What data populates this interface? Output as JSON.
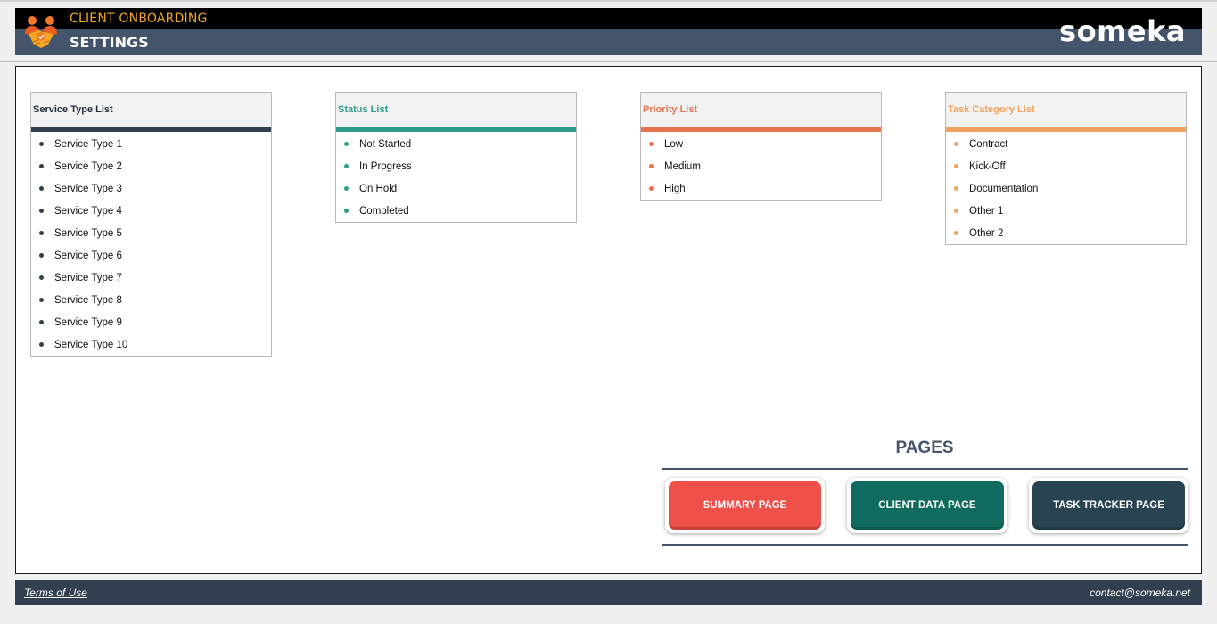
{
  "header": {
    "app_title": "CLIENT ONBOARDING",
    "page_title": "SETTINGS",
    "brand": "someka"
  },
  "lists": {
    "service": {
      "title": "Service Type List",
      "color": "#323f4f",
      "items": [
        "Service Type 1",
        "Service Type 2",
        "Service Type 3",
        "Service Type 4",
        "Service Type 5",
        "Service Type 6",
        "Service Type 7",
        "Service Type 8",
        "Service Type 9",
        "Service Type 10"
      ]
    },
    "status": {
      "title": "Status List",
      "color": "#2e9b8c",
      "items": [
        "Not Started",
        "In Progress",
        "On Hold",
        "Completed"
      ]
    },
    "priority": {
      "title": "Priority List",
      "color": "#e8734f",
      "items": [
        "Low",
        "Medium",
        "High"
      ]
    },
    "task_category": {
      "title": "Task Category List",
      "color": "#f0a35e",
      "items": [
        "Contract",
        "Kick-Off",
        "Documentation",
        "Other 1",
        "Other 2"
      ]
    }
  },
  "pages": {
    "title": "PAGES",
    "buttons": {
      "summary": "SUMMARY PAGE",
      "client_data": "CLIENT DATA PAGE",
      "task_tracker": "TASK TRACKER PAGE"
    },
    "colors": {
      "summary": "#f0504a",
      "client_data": "#0e6b5e",
      "task_tracker": "#274450"
    }
  },
  "footer": {
    "terms": "Terms of Use",
    "contact": "contact@someka.net"
  }
}
